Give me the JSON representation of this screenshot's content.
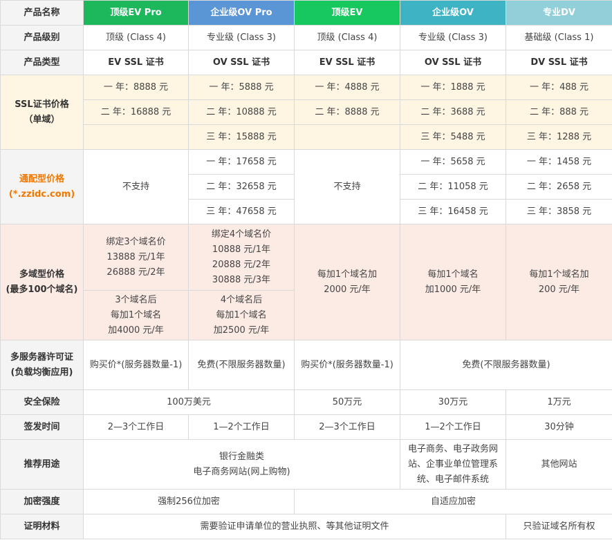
{
  "header": {
    "label": "产品名称",
    "products": [
      "顶级EV Pro",
      "企业级OV Pro",
      "顶级EV",
      "企业级OV",
      "专业DV"
    ]
  },
  "level": {
    "label": "产品级别",
    "values": [
      "顶级 (Class 4)",
      "专业级 (Class 3)",
      "顶级 (Class 4)",
      "专业级 (Class 3)",
      "基础级 (Class 1)"
    ]
  },
  "type": {
    "label": "产品类型",
    "values": [
      "EV SSL 证书",
      "OV SSL 证书",
      "EV SSL 证书",
      "OV SSL 证书",
      "DV SSL 证书"
    ]
  },
  "ssl_price": {
    "label_line1": "SSL证书价格",
    "label_line2": "（单域）",
    "rows": [
      [
        "一 年：8888 元",
        "一 年：5888 元",
        "一 年：4888 元",
        "一 年：1888 元",
        "一 年：488 元"
      ],
      [
        "二 年：16888 元",
        "二 年：10888 元",
        "二 年：8888 元",
        "二 年：3688 元",
        "二 年：888 元"
      ],
      [
        "",
        "三 年：15888 元",
        "",
        "三 年：5488 元",
        "三 年：1288 元"
      ]
    ]
  },
  "wildcard": {
    "label_line1": "通配型价格",
    "label_line2": "(*.zzidc.com)",
    "not_supported": "不支持",
    "ovpro": [
      "一 年：17658 元",
      "二 年：32658 元",
      "三 年：47658 元"
    ],
    "ov": [
      "一 年：5658 元",
      "二 年：11058 元",
      "三 年：16458 元"
    ],
    "dv": [
      "一 年：1458 元",
      "二 年：2658 元",
      "三 年：3858 元"
    ]
  },
  "multidomain": {
    "label_line1": "多域型价格",
    "label_line2": "(最多100个域名)",
    "evpro_top": [
      "绑定3个域名价",
      "13888 元/1年",
      "26888 元/2年"
    ],
    "evpro_bottom": [
      "3个域名后",
      "每加1个域名",
      "加4000 元/年"
    ],
    "ovpro_top": [
      "绑定4个域名价",
      "10888 元/1年",
      "20888 元/2年",
      "30888 元/3年"
    ],
    "ovpro_bottom": [
      "4个域名后",
      "每加1个域名",
      "加2500 元/年"
    ],
    "ev": [
      "每加1个域名加",
      "2000 元/年"
    ],
    "ov": [
      "每加1个域名",
      "加1000 元/年"
    ],
    "dv": [
      "每加1个域名加",
      "200 元/年"
    ]
  },
  "servers": {
    "label_line1": "多服务器许可证",
    "label_line2": "(负载均衡应用)",
    "evpro": "购买价*(服务器数量-1)",
    "ovpro": "免费(不限服务器数量)",
    "ev": "购买价*(服务器数量-1)",
    "ov_dv": "免费(不限服务器数量)"
  },
  "insurance": {
    "label": "安全保险",
    "pro": "100万美元",
    "ev": "50万元",
    "ov": "30万元",
    "dv": "1万元"
  },
  "issue": {
    "label": "签发时间",
    "evpro": "2—3个工作日",
    "ovpro": "1—2个工作日",
    "ev": "2—3个工作日",
    "ov": "1—2个工作日",
    "dv": "30分钟"
  },
  "usage": {
    "label": "推荐用途",
    "main_line1": "银行金融类",
    "main_line2": "电子商务网站(网上购物)",
    "ov_lines": [
      "电子商务、电子政务网",
      "站、企事业单位管理系",
      "统、电子邮件系统"
    ],
    "dv": "其他网站"
  },
  "encryption": {
    "label": "加密强度",
    "pro": "强制256位加密",
    "others": "自适应加密"
  },
  "docs": {
    "label": "证明材料",
    "main": "需要验证申请单位的营业执照、等其他证明文件",
    "dv": "只验证域名所有权"
  }
}
